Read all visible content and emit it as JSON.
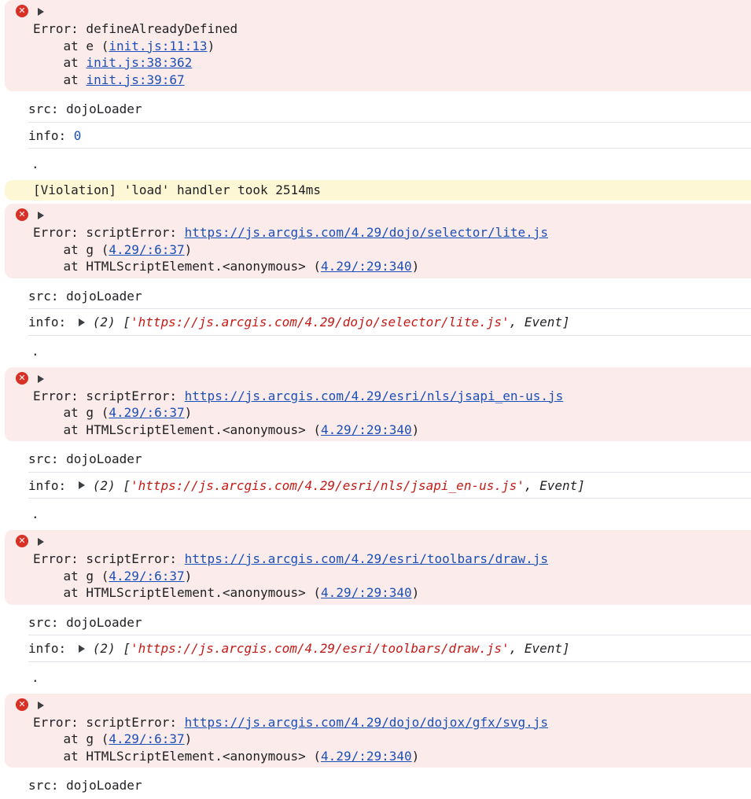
{
  "entries": [
    {
      "error": "Error: defineAlreadyDefined",
      "stack": [
        {
          "prefix": "    at e (",
          "link": "init.js:11:13",
          "suffix": ")"
        },
        {
          "prefix": "    at ",
          "link": "init.js:38:362",
          "suffix": ""
        },
        {
          "prefix": "    at ",
          "link": "init.js:39:67",
          "suffix": ""
        }
      ],
      "src": "src: dojoLoader",
      "info_label": "info: ",
      "info_value": "0"
    },
    {
      "warning": "[Violation] 'load' handler took 2514ms"
    },
    {
      "error_prefix": "Error: scriptError: ",
      "error_link": "https://js.arcgis.com/4.29/dojo/selector/lite.js",
      "stack": [
        {
          "prefix": "    at g (",
          "link": "4.29/:6:37",
          "suffix": ")"
        },
        {
          "prefix": "    at HTMLScriptElement.<anonymous> (",
          "link": "4.29/:29:340",
          "suffix": ")"
        }
      ],
      "src": "src: dojoLoader",
      "info_label": "info: ",
      "info_count": "(2) [",
      "info_str": "'https://js.arcgis.com/4.29/dojo/selector/lite.js'",
      "info_rest": ", Event]"
    },
    {
      "error_prefix": "Error: scriptError: ",
      "error_link": "https://js.arcgis.com/4.29/esri/nls/jsapi_en-us.js",
      "stack": [
        {
          "prefix": "    at g (",
          "link": "4.29/:6:37",
          "suffix": ")"
        },
        {
          "prefix": "    at HTMLScriptElement.<anonymous> (",
          "link": "4.29/:29:340",
          "suffix": ")"
        }
      ],
      "src": "src: dojoLoader",
      "info_label": "info: ",
      "info_count": "(2) [",
      "info_str": "'https://js.arcgis.com/4.29/esri/nls/jsapi_en-us.js'",
      "info_rest": ", Event]"
    },
    {
      "error_prefix": "Error: scriptError: ",
      "error_link": "https://js.arcgis.com/4.29/esri/toolbars/draw.js",
      "stack": [
        {
          "prefix": "    at g (",
          "link": "4.29/:6:37",
          "suffix": ")"
        },
        {
          "prefix": "    at HTMLScriptElement.<anonymous> (",
          "link": "4.29/:29:340",
          "suffix": ")"
        }
      ],
      "src": "src: dojoLoader",
      "info_label": "info: ",
      "info_count": "(2) [",
      "info_str": "'https://js.arcgis.com/4.29/esri/toolbars/draw.js'",
      "info_rest": ", Event]"
    },
    {
      "error_prefix": "Error: scriptError: ",
      "error_link": "https://js.arcgis.com/4.29/dojo/dojox/gfx/svg.js",
      "stack": [
        {
          "prefix": "    at g (",
          "link": "4.29/:6:37",
          "suffix": ")"
        },
        {
          "prefix": "    at HTMLScriptElement.<anonymous> (",
          "link": "4.29/:29:340",
          "suffix": ")"
        }
      ],
      "src": "src: dojoLoader"
    }
  ],
  "dot": ".",
  "icons": {
    "error": "error-x-icon",
    "expand": "expand-triangle-icon"
  },
  "colors": {
    "error_bg": "#fcebeb",
    "warning_bg": "#fef7d6",
    "link": "#1a4fb8",
    "string": "#c41a16"
  }
}
